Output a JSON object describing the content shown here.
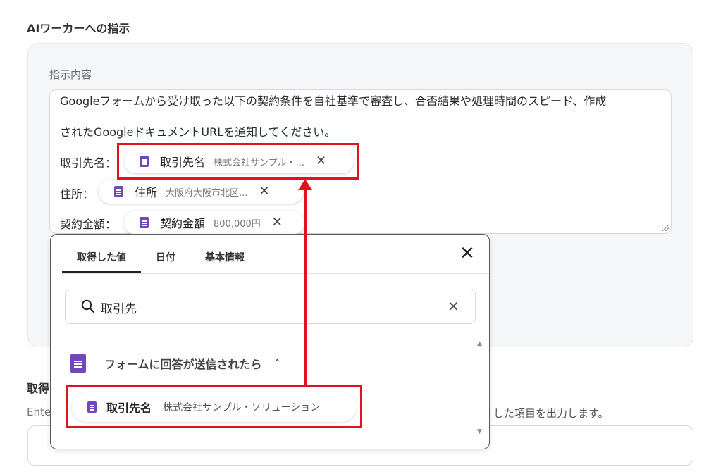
{
  "section_title": "AIワーカーへの指示",
  "instruction": {
    "field_label": "指示内容",
    "line1": "Googleフォームから受け取った以下の契約条件を自社基準で審査し、合否結果や処理時間のスピード、作成",
    "line2": "されたGoogleドキュメントURLを通知してください。",
    "rows": [
      {
        "prefix": "取引先名：",
        "chip_label": "取引先名",
        "chip_value": "株式会社サンプル・...",
        "remove": "✕"
      },
      {
        "prefix": "住所：",
        "chip_label": "住所",
        "chip_value": "大阪府大阪市北区...",
        "remove": "✕"
      },
      {
        "prefix": "契約金額：",
        "chip_label": "契約金額",
        "chip_value": "800,000円",
        "remove": "✕"
      }
    ]
  },
  "background": {
    "label": "取得",
    "desc_left": "Ente",
    "desc_right": "した項目を出力します。"
  },
  "popup": {
    "tabs": [
      "取得した値",
      "日付",
      "基本情報"
    ],
    "active_tab": "取得した値",
    "close": "✕",
    "search_value": "取引先",
    "search_clear": "✕",
    "group_label": "フォームに回答が送信されたら",
    "group_chevron": "⌃",
    "result": {
      "label": "取引先名",
      "value": "株式会社サンプル・ソリューション"
    },
    "scroll_up": "▲",
    "scroll_down": "▼"
  },
  "colors": {
    "accent_red": "#e0141e",
    "forms_purple": "#7248b9"
  }
}
